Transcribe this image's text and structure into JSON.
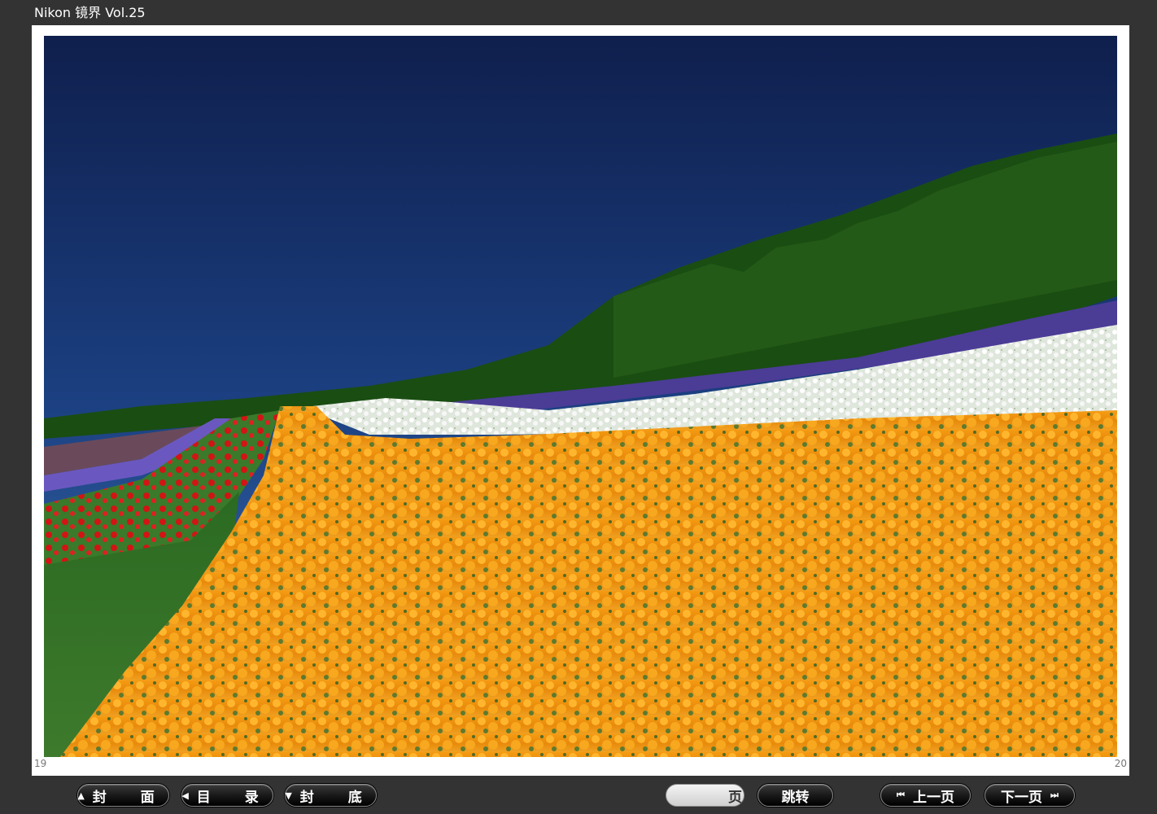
{
  "window": {
    "title": "Nikon 镜界 Vol.25"
  },
  "page_numbers": {
    "left": "19",
    "right": "20"
  },
  "nav": {
    "cover_label": "封 面",
    "toc_label": "目 录",
    "back_cover_label": "封 底",
    "page_suffix": "页",
    "page_value": "",
    "jump_label": "跳转",
    "prev_label": "上一页",
    "next_label": "下一页"
  },
  "icons": {
    "cover": "triangle-up-icon",
    "toc": "triangle-left-icon",
    "back_cover": "triangle-down-icon",
    "prev": "skip-back-icon",
    "next": "skip-forward-icon"
  },
  "colors": {
    "background": "#333333",
    "page": "#ffffff",
    "button_text": "#ffffff"
  }
}
